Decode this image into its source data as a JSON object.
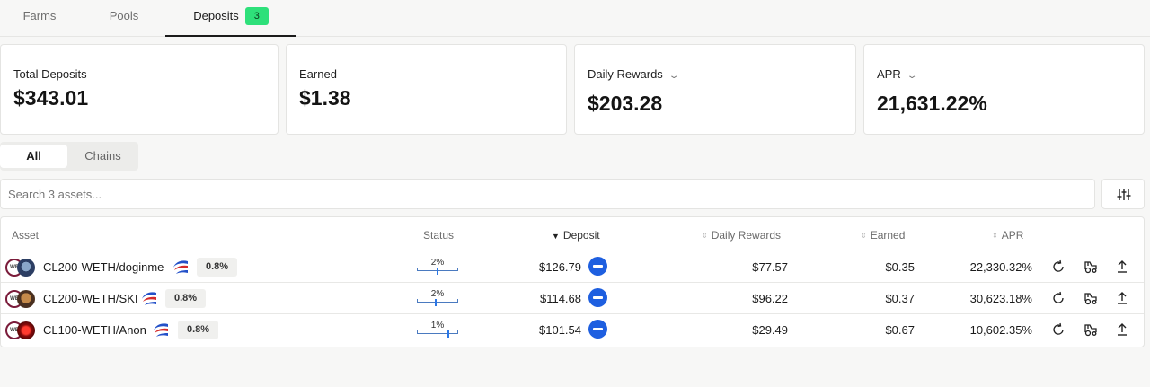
{
  "tabs": [
    {
      "label": "Farms"
    },
    {
      "label": "Pools"
    },
    {
      "label": "Deposits",
      "badge": "3"
    }
  ],
  "cards": {
    "total_deposits": {
      "label": "Total Deposits",
      "value": "$343.01"
    },
    "earned": {
      "label": "Earned",
      "value": "$1.38"
    },
    "daily_rewards": {
      "label": "Daily Rewards",
      "value": "$203.28"
    },
    "apr": {
      "label": "APR",
      "value": "21,631.22%"
    }
  },
  "filter": {
    "all_label": "All",
    "chains_label": "Chains"
  },
  "search": {
    "placeholder": "Search 3 assets..."
  },
  "table": {
    "headers": {
      "asset": "Asset",
      "status": "Status",
      "deposit": "Deposit",
      "daily_rewards": "Daily Rewards",
      "earned": "Earned",
      "apr": "APR"
    },
    "rows": [
      {
        "asset": "CL200-WETH/doginme",
        "fee": "0.8%",
        "status": "2%",
        "status_value": 0.5,
        "deposit": "$126.79",
        "daily_rewards": "$77.57",
        "earned": "$0.35",
        "apr": "22,330.32%"
      },
      {
        "asset": "CL200-WETH/SKI",
        "fee": "0.8%",
        "status": "2%",
        "status_value": 0.45,
        "deposit": "$114.68",
        "daily_rewards": "$96.22",
        "earned": "$0.37",
        "apr": "30,623.18%"
      },
      {
        "asset": "CL100-WETH/Anon",
        "fee": "0.8%",
        "status": "1%",
        "status_value": 0.75,
        "deposit": "$101.54",
        "daily_rewards": "$29.49",
        "earned": "$0.67",
        "apr": "10,602.35%"
      }
    ]
  },
  "colors": {
    "accent": "#1e5fe0",
    "badge": "#2ee07a"
  },
  "icons": {
    "row_actions": [
      "refresh-icon",
      "harvest-tractor-icon",
      "withdraw-upload-icon"
    ],
    "filter": "sliders-icon"
  }
}
